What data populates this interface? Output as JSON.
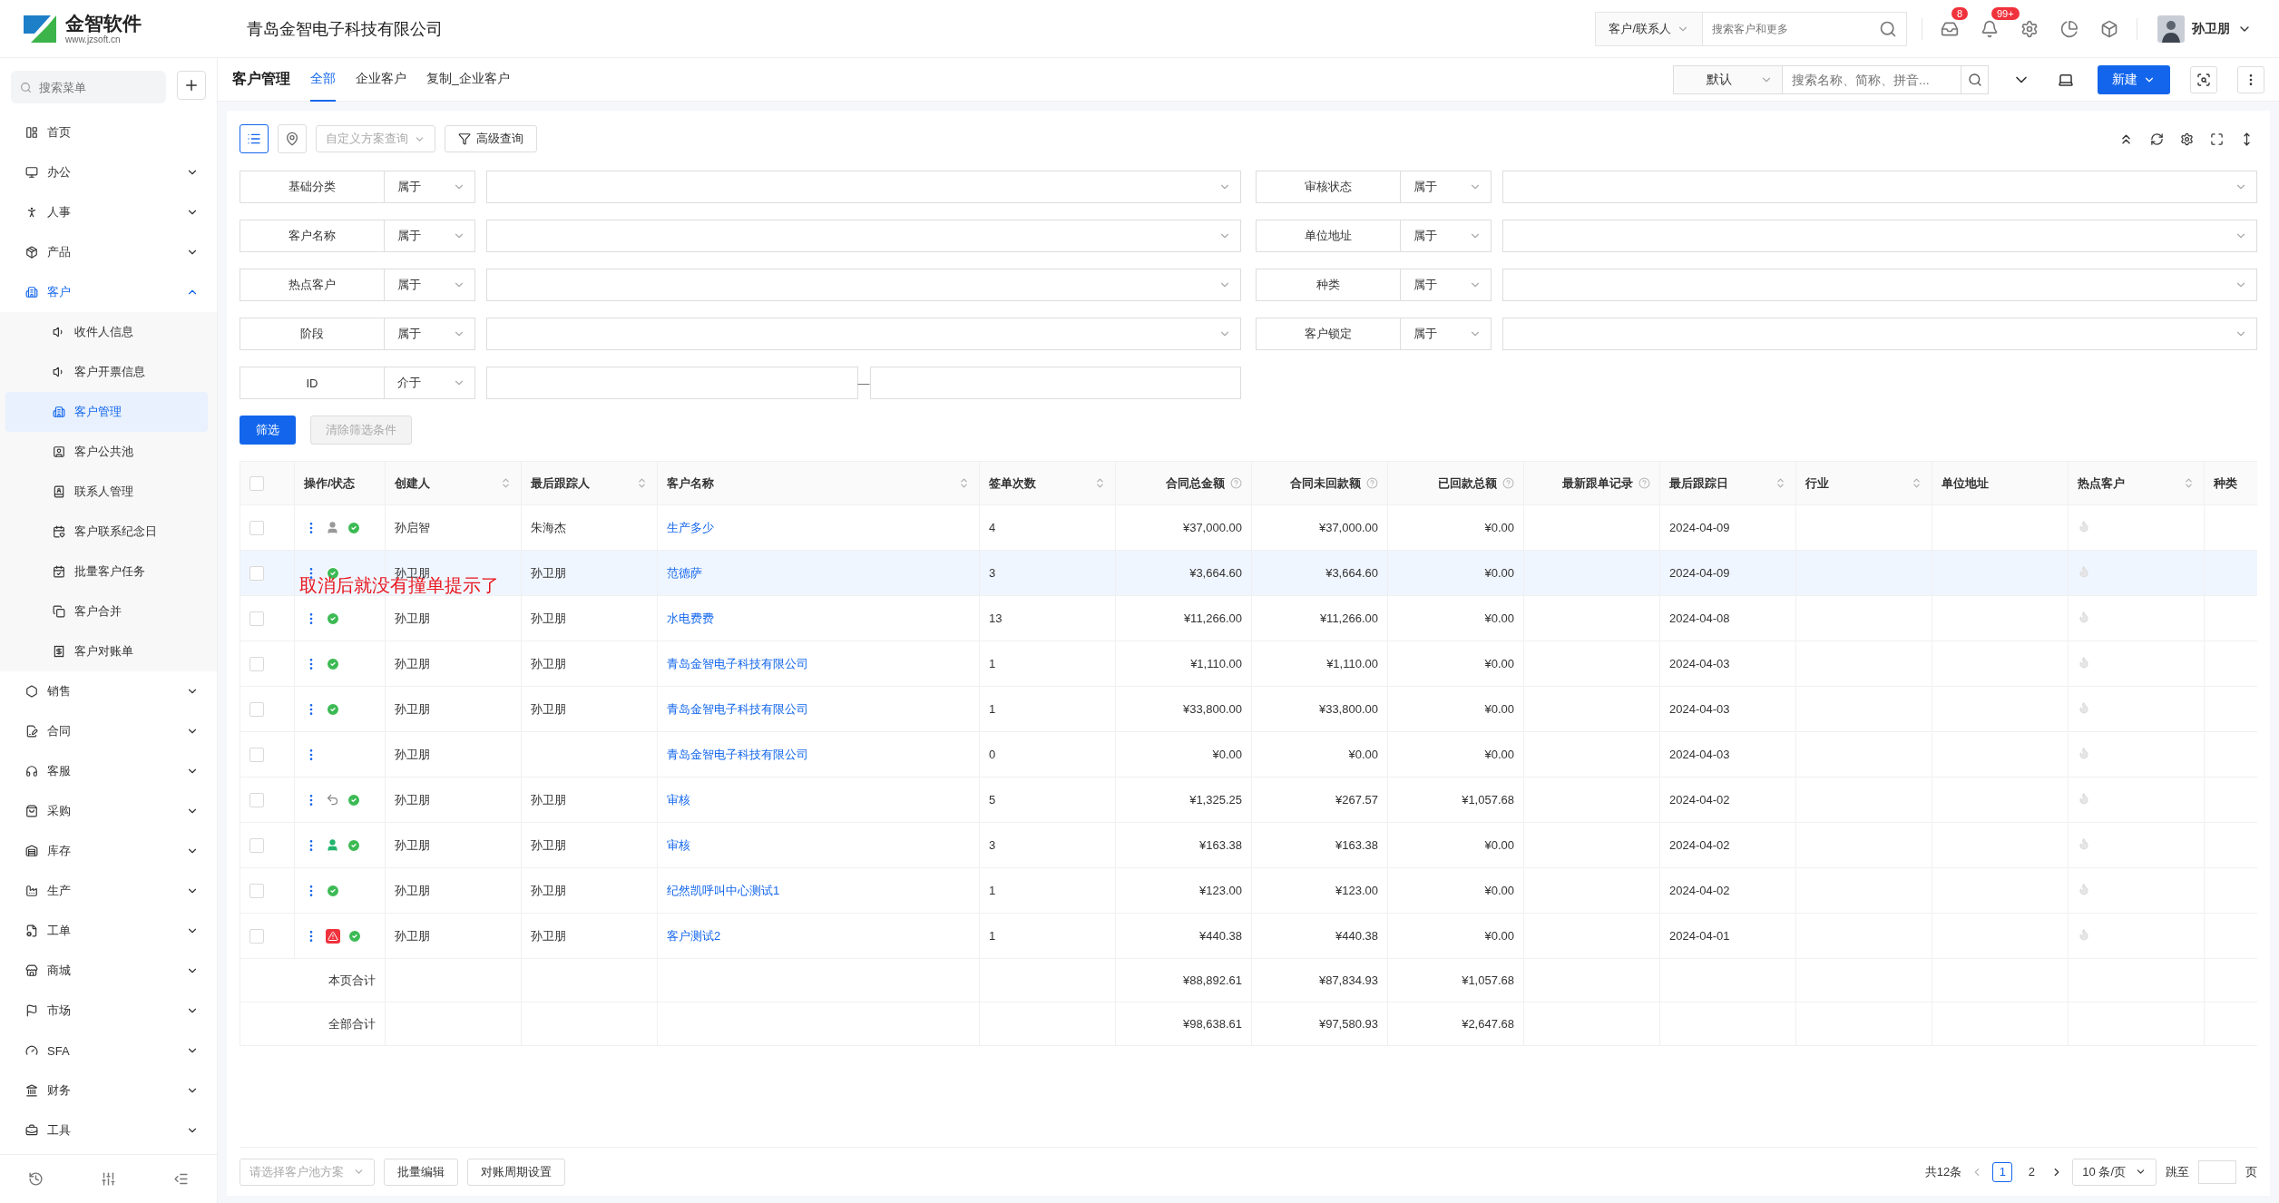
{
  "logo": {
    "name": "金智软件",
    "url": "www.jzsoft.cn"
  },
  "company": "青岛金智电子科技有限公司",
  "header": {
    "scope": "客户/联系人",
    "search_placeholder": "搜索客户和更多",
    "message_count": "8",
    "notice_count": "99+",
    "user": "孙卫朋"
  },
  "sidebar": {
    "search_placeholder": "搜索菜单",
    "items": [
      {
        "label": "首页",
        "selected": false
      },
      {
        "label": "办公",
        "expanded": false,
        "selected": false
      },
      {
        "label": "人事",
        "expanded": false,
        "selected": false
      },
      {
        "label": "产品",
        "expanded": false,
        "selected": false
      },
      {
        "label": "客户",
        "expanded": true,
        "selected": true,
        "children": [
          {
            "label": "收件人信息",
            "selected": false
          },
          {
            "label": "客户开票信息",
            "selected": false
          },
          {
            "label": "客户管理",
            "selected": true
          },
          {
            "label": "客户公共池",
            "selected": false
          },
          {
            "label": "联系人管理",
            "selected": false
          },
          {
            "label": "客户联系纪念日",
            "selected": false
          },
          {
            "label": "批量客户任务",
            "selected": false
          },
          {
            "label": "客户合并",
            "selected": false
          },
          {
            "label": "客户对账单",
            "selected": false
          }
        ]
      },
      {
        "label": "销售",
        "expanded": false,
        "selected": false
      },
      {
        "label": "合同",
        "expanded": false,
        "selected": false
      },
      {
        "label": "客服",
        "expanded": false,
        "selected": false
      },
      {
        "label": "采购",
        "expanded": false,
        "selected": false
      },
      {
        "label": "库存",
        "expanded": false,
        "selected": false
      },
      {
        "label": "生产",
        "expanded": false,
        "selected": false
      },
      {
        "label": "工单",
        "expanded": false,
        "selected": false
      },
      {
        "label": "商城",
        "expanded": false,
        "selected": false
      },
      {
        "label": "市场",
        "expanded": false,
        "selected": false
      },
      {
        "label": "SFA",
        "expanded": false,
        "selected": false
      },
      {
        "label": "财务",
        "expanded": false,
        "selected": false
      },
      {
        "label": "工具",
        "expanded": false,
        "selected": false
      }
    ]
  },
  "page": {
    "title": "客户管理",
    "tabs": [
      {
        "label": "全部",
        "selected": true
      },
      {
        "label": "企业客户",
        "selected": false
      },
      {
        "label": "复制_企业客户",
        "selected": false
      }
    ],
    "view": "默认",
    "search_placeholder": "搜索名称、简称、拼音...",
    "new_button": "新建"
  },
  "filter_bar": {
    "views": [
      {
        "kind": "list",
        "selected": true
      },
      {
        "kind": "map",
        "selected": false
      }
    ],
    "scheme_placeholder": "自定义方案查询",
    "advanced": "高级查询"
  },
  "filters": [
    {
      "label": "基础分类",
      "operator": "属于",
      "kind": "select"
    },
    {
      "label": "审核状态",
      "operator": "属于",
      "kind": "select"
    },
    {
      "label": "客户名称",
      "operator": "属于",
      "kind": "select"
    },
    {
      "label": "单位地址",
      "operator": "属于",
      "kind": "select"
    },
    {
      "label": "热点客户",
      "operator": "属于",
      "kind": "select"
    },
    {
      "label": "种类",
      "operator": "属于",
      "kind": "select"
    },
    {
      "label": "阶段",
      "operator": "属于",
      "kind": "select"
    },
    {
      "label": "客户锁定",
      "operator": "属于",
      "kind": "select"
    },
    {
      "label": "ID",
      "operator": "介于",
      "kind": "range",
      "separator": "—"
    }
  ],
  "filter_buttons": {
    "apply": "筛选",
    "clear": {
      "label": "清除筛选条件",
      "disabled": true
    }
  },
  "table": {
    "all_checked": false,
    "columns": [
      {
        "label": "操作/状态",
        "sortable": false,
        "help": false
      },
      {
        "label": "创建人",
        "sortable": true,
        "help": false
      },
      {
        "label": "最后跟踪人",
        "sortable": true,
        "help": false
      },
      {
        "label": "客户名称",
        "sortable": true,
        "help": false
      },
      {
        "label": "签单次数",
        "sortable": true,
        "help": false
      },
      {
        "label": "合同总金额",
        "sortable": false,
        "help": true
      },
      {
        "label": "合同未回款额",
        "sortable": false,
        "help": true
      },
      {
        "label": "已回款总额",
        "sortable": false,
        "help": true
      },
      {
        "label": "最新跟单记录",
        "sortable": false,
        "help": true
      },
      {
        "label": "最后跟踪日",
        "sortable": true,
        "help": false
      },
      {
        "label": "行业",
        "sortable": true,
        "help": false
      },
      {
        "label": "单位地址",
        "sortable": false,
        "help": false
      },
      {
        "label": "热点客户",
        "sortable": true,
        "help": false
      },
      {
        "label": "种类",
        "help": false
      }
    ],
    "rows": [
      {
        "checked": false,
        "highlighted": false,
        "statuses": [
          {
            "kind": "shared"
          },
          {
            "kind": "approved"
          }
        ],
        "creator": "孙启智",
        "follower": "朱海杰",
        "name": "生产多少",
        "deals": "4",
        "total": "¥37,000.00",
        "unpaid": "¥37,000.00",
        "paid": "¥0.00",
        "date": "2024-04-09",
        "hot": false
      },
      {
        "checked": false,
        "highlighted": true,
        "statuses": [
          {
            "kind": "approved"
          }
        ],
        "creator": "孙卫朋",
        "follower": "孙卫朋",
        "name": "范德萨",
        "deals": "3",
        "total": "¥3,664.60",
        "unpaid": "¥3,664.60",
        "paid": "¥0.00",
        "date": "2024-04-09",
        "hot": false
      },
      {
        "checked": false,
        "highlighted": false,
        "statuses": [
          {
            "kind": "approved"
          }
        ],
        "creator": "孙卫朋",
        "follower": "孙卫朋",
        "name": "水电费费",
        "deals": "13",
        "total": "¥11,266.00",
        "unpaid": "¥11,266.00",
        "paid": "¥0.00",
        "date": "2024-04-08",
        "hot": false
      },
      {
        "checked": false,
        "highlighted": false,
        "statuses": [
          {
            "kind": "approved"
          }
        ],
        "creator": "孙卫朋",
        "follower": "孙卫朋",
        "name": "青岛金智电子科技有限公司",
        "deals": "1",
        "total": "¥1,110.00",
        "unpaid": "¥1,110.00",
        "paid": "¥0.00",
        "date": "2024-04-03",
        "hot": false
      },
      {
        "checked": false,
        "highlighted": false,
        "statuses": [
          {
            "kind": "approved"
          }
        ],
        "creator": "孙卫朋",
        "follower": "孙卫朋",
        "name": "青岛金智电子科技有限公司",
        "deals": "1",
        "total": "¥33,800.00",
        "unpaid": "¥33,800.00",
        "paid": "¥0.00",
        "date": "2024-04-03",
        "hot": false
      },
      {
        "checked": false,
        "highlighted": false,
        "creator": "孙卫朋",
        "name": "青岛金智电子科技有限公司",
        "deals": "0",
        "total": "¥0.00",
        "unpaid": "¥0.00",
        "paid": "¥0.00",
        "date": "2024-04-03",
        "hot": false
      },
      {
        "checked": false,
        "highlighted": false,
        "statuses": [
          {
            "kind": "returned"
          },
          {
            "kind": "approved"
          }
        ],
        "creator": "孙卫朋",
        "follower": "孙卫朋",
        "name": "审核",
        "deals": "5",
        "total": "¥1,325.25",
        "unpaid": "¥267.57",
        "paid": "¥1,057.68",
        "date": "2024-04-02",
        "hot": false
      },
      {
        "checked": false,
        "highlighted": false,
        "statuses": [
          {
            "kind": "owned"
          },
          {
            "kind": "approved"
          }
        ],
        "creator": "孙卫朋",
        "follower": "孙卫朋",
        "name": "审核",
        "deals": "3",
        "total": "¥163.38",
        "unpaid": "¥163.38",
        "paid": "¥0.00",
        "date": "2024-04-02",
        "hot": false
      },
      {
        "checked": false,
        "highlighted": false,
        "statuses": [
          {
            "kind": "approved"
          }
        ],
        "creator": "孙卫朋",
        "follower": "孙卫朋",
        "name": "纪然凯呼叫中心测试1",
        "deals": "1",
        "total": "¥123.00",
        "unpaid": "¥123.00",
        "paid": "¥0.00",
        "date": "2024-04-02",
        "hot": false
      },
      {
        "checked": false,
        "highlighted": false,
        "statuses": [
          {
            "kind": "warning"
          },
          {
            "kind": "approved"
          }
        ],
        "creator": "孙卫朋",
        "follower": "孙卫朋",
        "name": "客户测试2",
        "deals": "1",
        "total": "¥440.38",
        "unpaid": "¥440.38",
        "paid": "¥0.00",
        "date": "2024-04-01",
        "hot": false
      }
    ],
    "totals": [
      {
        "label": "本页合计",
        "total": "¥88,892.61",
        "unpaid": "¥87,834.93",
        "paid": "¥1,057.68"
      },
      {
        "label": "全部合计",
        "total": "¥98,638.61",
        "unpaid": "¥97,580.93",
        "paid": "¥2,647.68"
      }
    ]
  },
  "annotation": "取消后就没有撞单提示了",
  "footer": {
    "pool_placeholder": "请选择客户池方案",
    "buttons": [
      "批量编辑",
      "对账周期设置"
    ],
    "count": "共12条",
    "pages": [
      {
        "label": "1",
        "selected": true
      },
      {
        "label": "2",
        "selected": false
      }
    ],
    "page_size": "10 条/页",
    "jump": "跳至",
    "page_unit": "页"
  }
}
